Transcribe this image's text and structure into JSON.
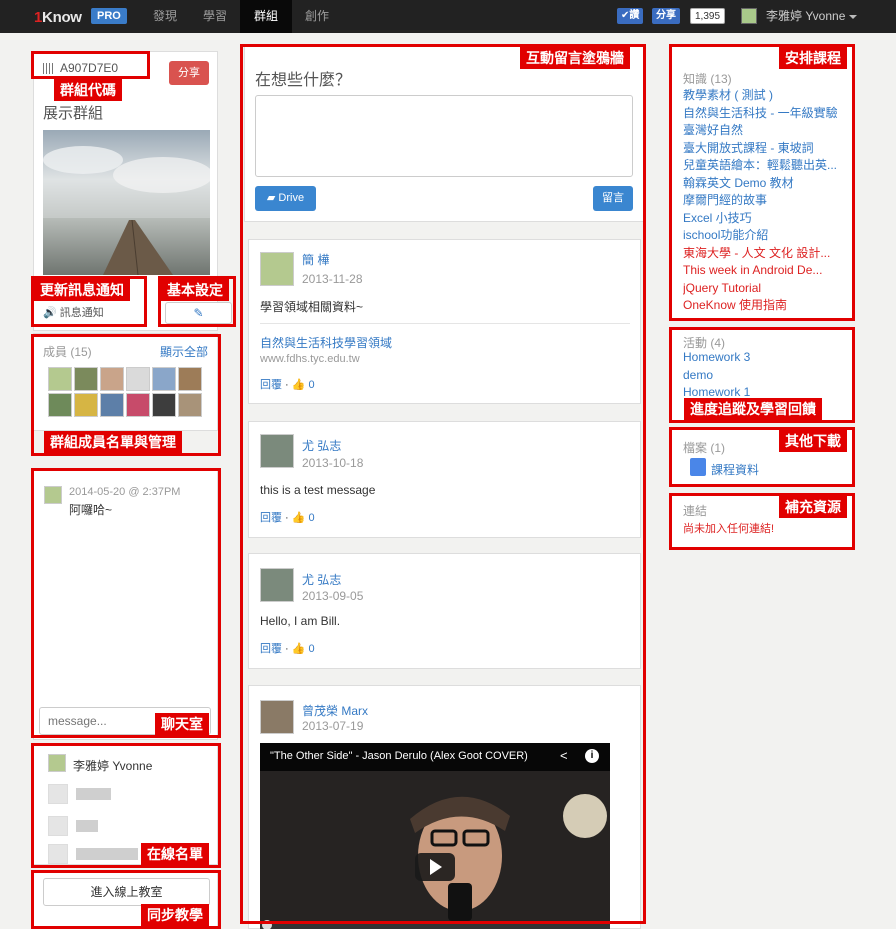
{
  "nav": {
    "logo_num": "1",
    "logo_text": "Know",
    "pro": "PRO",
    "items": [
      "發現",
      "學習",
      "群組",
      "創作"
    ],
    "like_label": "讚",
    "share_label": "分享",
    "share_count": "1,395",
    "user_name": "李雅婷 Yvonne"
  },
  "annotations": {
    "group_code": "群組代碼",
    "notify": "更新訊息通知",
    "settings": "基本設定",
    "members_mgmt": "群組成員名單與管理",
    "wall": "互動留言塗鴉牆",
    "chat": "聊天室",
    "online": "在線名單",
    "sync": "同步教學",
    "schedule": "安排課程",
    "progress": "進度追蹤及學習回饋",
    "download": "其他下載",
    "resources": "補充資源"
  },
  "group": {
    "code": "A907D7E0",
    "share": "分享",
    "name": "展示群組",
    "notify_label": "訊息通知",
    "members_title": "成員 (15)",
    "show_all": "顯示全部"
  },
  "chat": {
    "timestamp": "2014-05-20 @ 2:37PM",
    "message": "阿囉哈~",
    "placeholder": "message..."
  },
  "online": {
    "users": [
      "李雅婷 Yvonne"
    ]
  },
  "classroom_button": "進入線上教室",
  "wall": {
    "prompt": "在想些什麼？",
    "drive": "Drive",
    "post": "留言",
    "reply": "回覆",
    "posts": [
      {
        "author": "簡 樺",
        "date": "2013-11-28",
        "text": "學習領域相關資料~",
        "link_title": "自然與生活科技學習領域",
        "link_url": "www.fdhs.tyc.edu.tw",
        "likes": "0"
      },
      {
        "author": "尤 弘志",
        "date": "2013-10-18",
        "text": "this is a test message",
        "likes": "0"
      },
      {
        "author": "尤 弘志",
        "date": "2013-09-05",
        "text": "Hello, I am Bill.",
        "likes": "0"
      },
      {
        "author": "曾茂榮 Marx",
        "date": "2013-07-19",
        "video_title": "\"The Other Side\" - Jason Derulo (Alex Goot COVER)"
      }
    ]
  },
  "knowledge": {
    "title": "知識 (13)",
    "items": [
      {
        "label": "教學素材 ( 測試 )",
        "red": false
      },
      {
        "label": "自然與生活科技 - 一年級實驗",
        "red": false
      },
      {
        "label": "臺灣好自然",
        "red": false
      },
      {
        "label": "臺大開放式課程 - 東坡詞",
        "red": false
      },
      {
        "label": "兒童英語繪本：輕鬆聽出英...",
        "red": false
      },
      {
        "label": "翰霖英文 Demo 教材",
        "red": false
      },
      {
        "label": "摩爾門經的故事",
        "red": false
      },
      {
        "label": "Excel 小技巧",
        "red": false
      },
      {
        "label": "ischool功能介紹",
        "red": false
      },
      {
        "label": "東海大學 - 人文 文化 設計...",
        "red": true
      },
      {
        "label": "This week in Android De...",
        "red": true
      },
      {
        "label": "jQuery Tutorial",
        "red": true
      },
      {
        "label": "OneKnow 使用指南",
        "red": true
      }
    ]
  },
  "activities": {
    "title": "活動 (4)",
    "items": [
      "Homework 3",
      "demo",
      "Homework 1"
    ]
  },
  "files": {
    "title": "檔案 (1)",
    "items": [
      "課程資料"
    ]
  },
  "links": {
    "title": "連結",
    "empty": "尚未加入任何連結!"
  },
  "colors": {
    "nav_bg": "#222222",
    "annotation_red": "#e10000",
    "link_blue": "#3479c4",
    "button_blue": "#3a86d0",
    "share_red": "#d9534f"
  }
}
